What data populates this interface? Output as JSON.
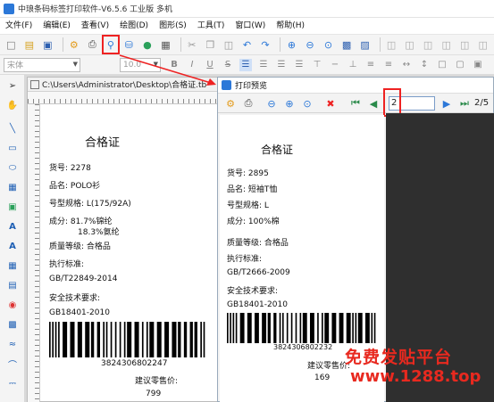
{
  "app": {
    "title": "中琅条码标签打印软件-V6.5.6 工业版 多机",
    "menu": [
      "文件(F)",
      "编辑(E)",
      "查看(V)",
      "绘图(D)",
      "图形(S)",
      "工具(T)",
      "窗口(W)",
      "帮助(H)"
    ]
  },
  "format_bar": {
    "font_name": "宋体",
    "font_size": "10.0"
  },
  "document": {
    "path": "C:\\Users\\Administrator\\Desktop\\合格证.tb",
    "label": {
      "title": "合格证",
      "goods_no": "货号:  2278",
      "name": "品名:  POLO衫",
      "size": "号型规格:  L(175/92A)",
      "composition1": "成分: 81.7%锦纶",
      "composition2": "18.3%氨纶",
      "grade": "质量等级:  合格品",
      "standard_label": "执行标准:",
      "standard": "GB/T22849-2014",
      "safety_label": "安全技术要求:",
      "safety": "GB18401-2010",
      "barcode": "3824306802247",
      "price_label": "建议零售价:",
      "price": "799"
    }
  },
  "preview": {
    "title": "打印预览",
    "page_input": "2",
    "page_total": "2/5",
    "label": {
      "title": "合格证",
      "goods_no": "货号:  2895",
      "name": "品名:  短袖T恤",
      "size": "号型规格:  L",
      "composition": "成分:  100%棉",
      "grade": "质量等级:  合格品",
      "standard_label": "执行标准:",
      "standard": "GB/T2666-2009",
      "safety_label": "安全技术要求:",
      "safety": "GB18401-2010",
      "barcode": "3824306802232",
      "price_label": "建议零售价:",
      "price": "169"
    }
  },
  "watermark": {
    "line1": "免费发贴平台",
    "line2": "www.1288.top"
  },
  "colors": {
    "highlight": "#e22222",
    "watermark": "#e8291f",
    "accent": "#2c78d8"
  }
}
